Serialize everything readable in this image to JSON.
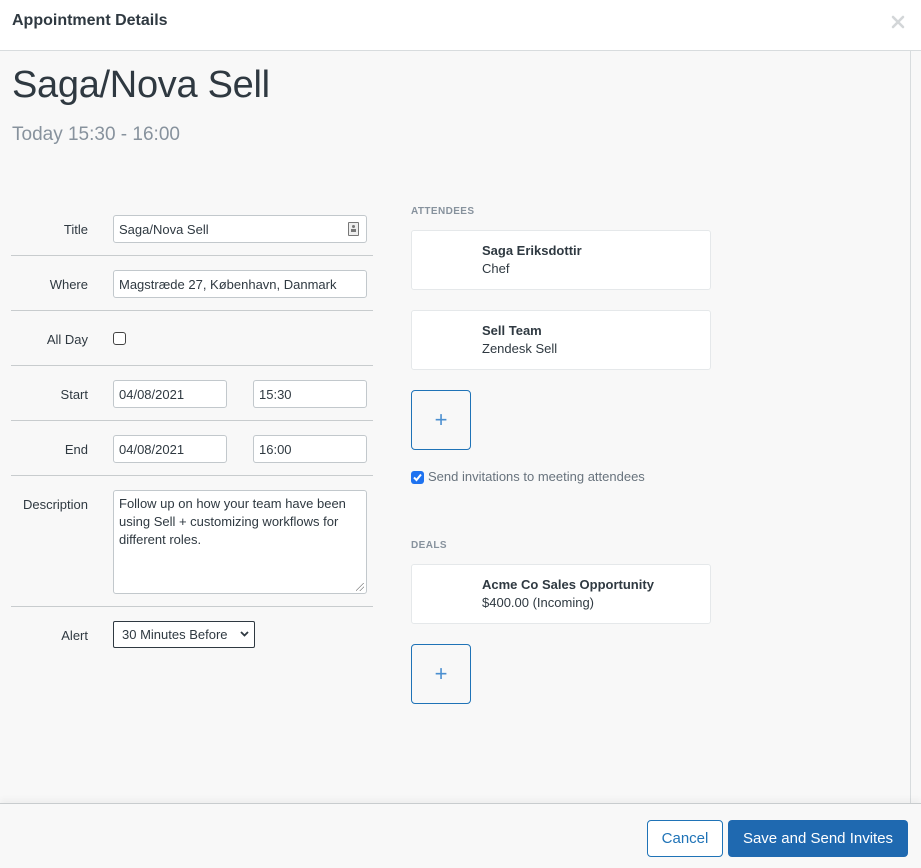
{
  "header": {
    "title": "Appointment Details",
    "close_icon": "close-icon"
  },
  "appointment": {
    "title": "Saga/Nova Sell",
    "time": "Today 15:30 - 16:00"
  },
  "form": {
    "title": {
      "label": "Title",
      "value": "Saga/Nova Sell",
      "icon": "contact-card-icon"
    },
    "where": {
      "label": "Where",
      "value": "Magstræde 27, København, Danmark"
    },
    "all_day": {
      "label": "All Day",
      "checked": false
    },
    "start": {
      "label": "Start",
      "date": "04/08/2021",
      "time": "15:30"
    },
    "end": {
      "label": "End",
      "date": "04/08/2021",
      "time": "16:00"
    },
    "description": {
      "label": "Description",
      "value": "Follow up on how your team have been using Sell + customizing workflows for different roles."
    },
    "alert": {
      "label": "Alert",
      "selected": "30 Minutes Before",
      "icon": "chevron-down-icon"
    }
  },
  "attendees": {
    "section_label": "ATTENDEES",
    "items": [
      {
        "name": "Saga Eriksdottir",
        "subtitle": "Chef"
      },
      {
        "name": "Sell Team",
        "subtitle": "Zendesk Sell"
      }
    ],
    "add_label": "+",
    "send_invitations": {
      "label": "Send invitations to meeting attendees",
      "checked": true
    }
  },
  "deals": {
    "section_label": "DEALS",
    "items": [
      {
        "name": "Acme Co Sales Opportunity",
        "subtitle": "$400.00 (Incoming)"
      }
    ],
    "add_label": "+"
  },
  "footer": {
    "cancel_label": "Cancel",
    "save_label": "Save and Send Invites"
  },
  "colors": {
    "primary": "#1f69b0",
    "text": "#2f3941",
    "muted": "#87929d",
    "checkbox_accent": "#1f73f0"
  }
}
